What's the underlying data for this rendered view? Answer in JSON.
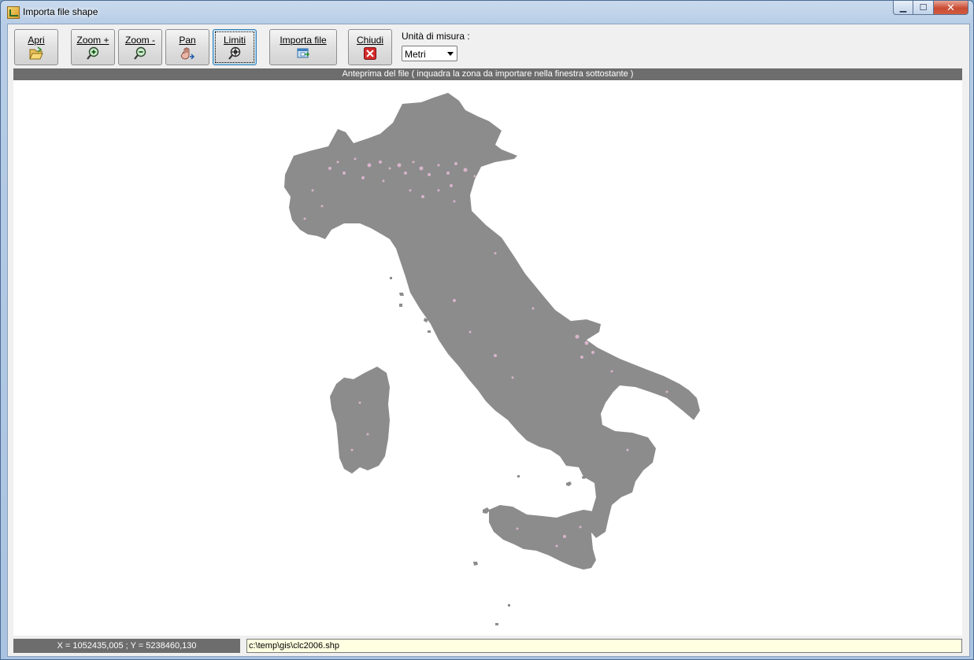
{
  "window": {
    "title": "Importa file shape"
  },
  "window_buttons": {
    "minimize": "▁",
    "maximize": "☐",
    "close": "✕"
  },
  "toolbar": {
    "buttons": [
      {
        "label": "Apri",
        "icon": "folder-open-icon"
      },
      {
        "label": "Zoom +",
        "icon": "zoom-in-icon"
      },
      {
        "label": "Zoom -",
        "icon": "zoom-out-icon"
      },
      {
        "label": "Pan",
        "icon": "pan-hand-icon"
      },
      {
        "label": "Limiti",
        "icon": "zoom-extents-icon"
      },
      {
        "label": "Importa file",
        "icon": "import-file-icon"
      },
      {
        "label": "Chiudi",
        "icon": "close-red-icon"
      }
    ],
    "unit_label": "Unità di misura :",
    "unit_value": "Metri"
  },
  "preview": {
    "header": "Anteprima del file ( inquadra la zona da importare nella finestra sottostante )",
    "map_fill": "#8c8c8c",
    "urban_fill": "#d8b4cc"
  },
  "status": {
    "coordinates": "X = 1052435,005 ; Y = 5238460,130",
    "file_path": "c:\\temp\\gis\\clc2006.shp"
  }
}
